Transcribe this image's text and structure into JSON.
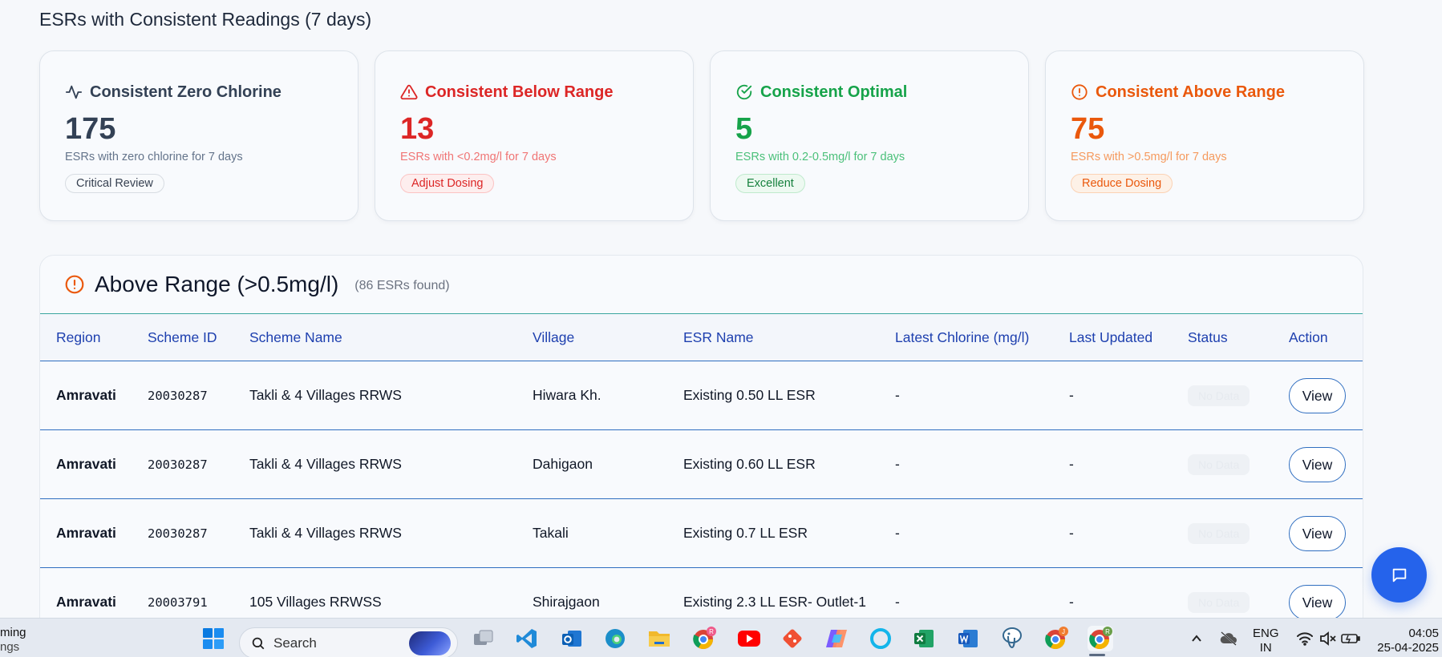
{
  "section": {
    "title": "ESRs with Consistent Readings (7 days)"
  },
  "cards": [
    {
      "title": "Consistent Zero Chlorine",
      "count": "175",
      "desc": "ESRs with zero chlorine for 7 days",
      "badge": "Critical Review",
      "icon": "activity-icon",
      "color": "#334155"
    },
    {
      "title": "Consistent Below Range",
      "count": "13",
      "desc": "ESRs with <0.2mg/l for 7 days",
      "badge": "Adjust Dosing",
      "icon": "alert-triangle-icon",
      "color": "#dc2626"
    },
    {
      "title": "Consistent Optimal",
      "count": "5",
      "desc": "ESRs with 0.2-0.5mg/l for 7 days",
      "badge": "Excellent",
      "icon": "check-circle-icon",
      "color": "#16a34a"
    },
    {
      "title": "Consistent Above Range",
      "count": "75",
      "desc": "ESRs with >0.5mg/l for 7 days",
      "badge": "Reduce Dosing",
      "icon": "alert-circle-icon",
      "color": "#ea580c"
    }
  ],
  "panel": {
    "title": "Above Range (>0.5mg/l)",
    "count": "(86 ESRs found)",
    "columns": [
      "Region",
      "Scheme ID",
      "Scheme Name",
      "Village",
      "ESR Name",
      "Latest Chlorine (mg/l)",
      "Last Updated",
      "Status",
      "Action"
    ],
    "rows": [
      {
        "region": "Amravati",
        "scheme_id": "20030287",
        "scheme_name": "Takli & 4 Villages RRWS",
        "village": "Hiwara Kh.",
        "esr_name": "Existing 0.50 LL ESR",
        "chlorine": "-",
        "updated": "-",
        "status": "No Data",
        "action": "View"
      },
      {
        "region": "Amravati",
        "scheme_id": "20030287",
        "scheme_name": "Takli & 4 Villages RRWS",
        "village": "Dahigaon",
        "esr_name": "Existing 0.60 LL ESR",
        "chlorine": "-",
        "updated": "-",
        "status": "No Data",
        "action": "View"
      },
      {
        "region": "Amravati",
        "scheme_id": "20030287",
        "scheme_name": "Takli & 4 Villages RRWS",
        "village": "Takali",
        "esr_name": "Existing 0.7 LL ESR",
        "chlorine": "-",
        "updated": "-",
        "status": "No Data",
        "action": "View"
      },
      {
        "region": "Amravati",
        "scheme_id": "20003791",
        "scheme_name": "105 Villages RRWSS",
        "village": "Shirajgaon",
        "esr_name": "Existing 2.3 LL ESR- Outlet-1",
        "chlorine": "-",
        "updated": "-",
        "status": "No Data",
        "action": "View"
      }
    ]
  },
  "taskbar": {
    "left_line1": "ming",
    "left_line2": "ngs",
    "search_label": "Search",
    "lang_line1": "ENG",
    "lang_line2": "IN",
    "time": "04:05",
    "date": "25-04-2025",
    "apps": [
      "windows-start-icon",
      "task-view-icon",
      "vscode-icon",
      "outlook-icon",
      "edge-icon",
      "file-explorer-icon",
      "chrome-profile-r-icon",
      "youtube-icon",
      "git-icon",
      "copilot-icon",
      "alexa-icon",
      "excel-icon",
      "word-icon",
      "postgres-icon",
      "chrome-profile-j-icon",
      "chrome-profile-active-icon"
    ],
    "badges": {
      "chrome_r": "R",
      "chrome_j": "J",
      "chrome_active": "R"
    }
  }
}
